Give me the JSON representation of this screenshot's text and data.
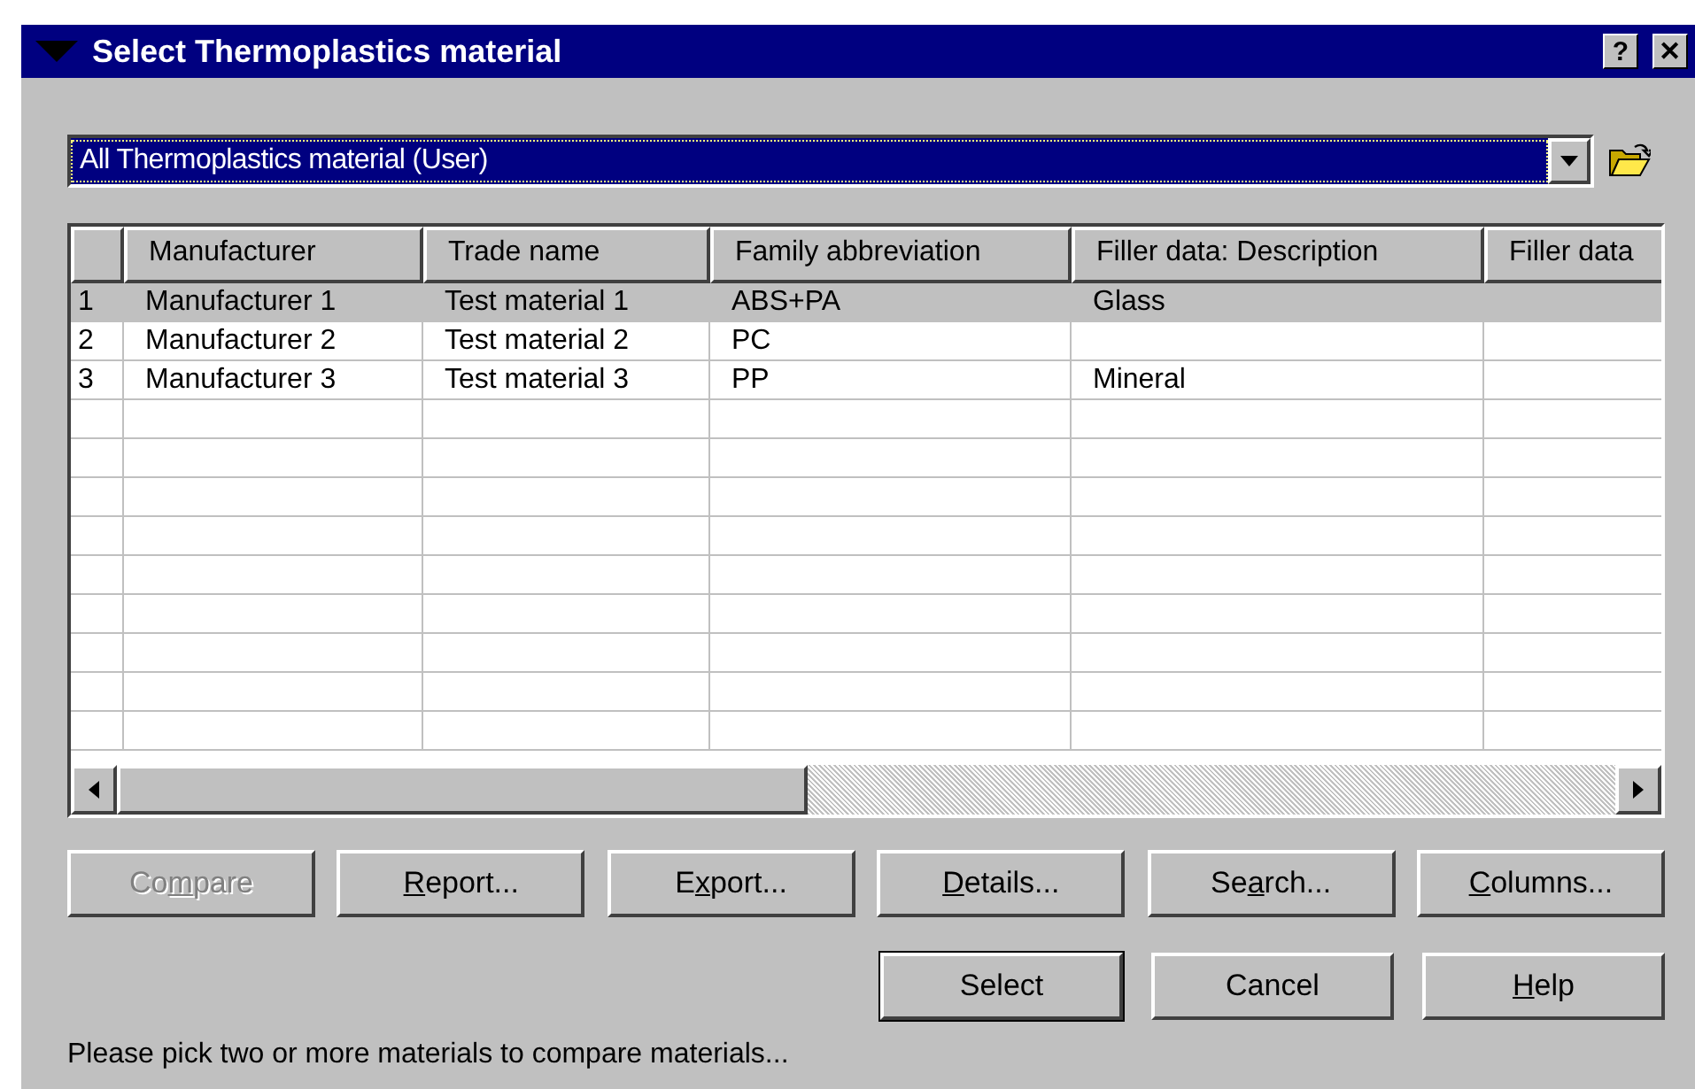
{
  "window": {
    "title": "Select Thermoplastics material"
  },
  "title_buttons": [
    "?",
    "✕"
  ],
  "database_select": {
    "value": "All Thermoplastics material (User)"
  },
  "table": {
    "columns": [
      "Manufacturer",
      "Trade name",
      "Family abbreviation",
      "Filler data: Description",
      "Filler data"
    ],
    "rows": [
      {
        "number": "1",
        "selected": true,
        "cells": [
          "Manufacturer 1",
          "Test material 1",
          "ABS+PA",
          "Glass"
        ]
      },
      {
        "number": "2",
        "selected": false,
        "cells": [
          "Manufacturer 2",
          "Test material 2",
          "PC"
        ]
      },
      {
        "number": "3",
        "selected": false,
        "cells": [
          "Manufacturer 3",
          "Test material 3",
          "PP",
          "Mineral"
        ]
      }
    ]
  },
  "action_buttons": [
    {
      "label": {
        "before": "Co",
        "key": "m",
        "after": "pare"
      },
      "disabled": true
    },
    {
      "label": {
        "key": "R",
        "after": "eport..."
      },
      "disabled": false
    },
    {
      "label": {
        "before": "E",
        "key": "x",
        "after": "port..."
      },
      "disabled": false
    },
    {
      "label": {
        "key": "D",
        "after": "etails..."
      },
      "disabled": false
    },
    {
      "label": {
        "before": "Se",
        "key": "a",
        "after": "rch..."
      },
      "disabled": false
    },
    {
      "label": {
        "key": "C",
        "after": "olumns..."
      },
      "disabled": false
    }
  ],
  "dialog_buttons": [
    {
      "label": {
        "before": "Select"
      },
      "default": true
    },
    {
      "label": {
        "before": "Cancel"
      },
      "default": false
    },
    {
      "label": {
        "key": "H",
        "after": "elp"
      },
      "default": false
    }
  ],
  "status": "Please pick two or more materials to compare materials..."
}
